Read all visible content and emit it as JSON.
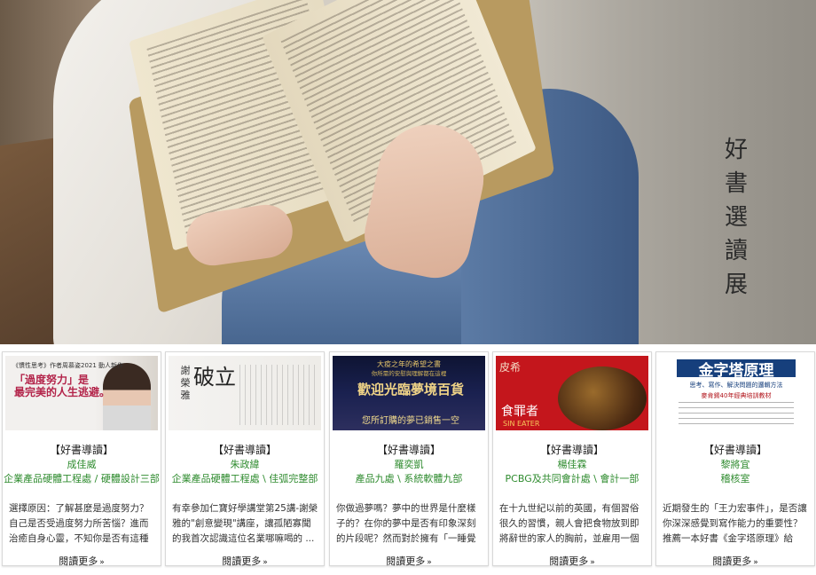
{
  "hero": {
    "title_chars": [
      "好",
      "書",
      "選",
      "讀",
      "展"
    ]
  },
  "cards": [
    {
      "cover": {
        "header": "《慣性思考》作者周慕姿2021 動人新作",
        "title_line1": "「過度努力」是",
        "title_line2": "最完美的人生逃避。"
      },
      "tag": "【好書導讀】",
      "person": "成佳威",
      "dept": "企業產品硬體工程處 / 硬體設計三部",
      "excerpt": "選擇原因：了解甚麼是過度努力？自己是否受過度努力所苦惱？進而治癒自身心靈，不知你是否有這種感覺 ...",
      "more": "閱讀更多"
    },
    {
      "cover": {
        "author": "謝榮雅",
        "title": "破立"
      },
      "tag": "【好書導讀】",
      "person": "朱政緯",
      "dept": "企業產品硬體工程處 \\ 佳弧完整部",
      "excerpt": "有幸參加仁寶好學講堂第25講-謝榮雅的\"創意變現\"講座，讓孤陋寡聞的我首次認識這位名業哪嘛喝的 ...",
      "more": "閱讀更多"
    },
    {
      "cover": {
        "top": "大疫之年的希望之書",
        "top2": "你所需的安慰與理解都在這裡",
        "title": "歡迎光臨夢境百貨",
        "sub": "您所訂購的夢已銷售一空"
      },
      "tag": "【好書導讀】",
      "person": "羅奕凱",
      "dept": "產品九處 \\ 系統軟體九部",
      "excerpt": "你做過夢嗎？夢中的世界是什麼樣子的？在你的夢中是否有印象深刻的片段呢？然而對於擁有「一睡覺就會 ...",
      "more": "閱讀更多"
    },
    {
      "cover": {
        "author": "皮希",
        "title": "食罪者",
        "en": "SIN EATER"
      },
      "tag": "【好書導讀】",
      "person": "楊佳霖",
      "dept": "PCBG及共同會計處 \\ 會計一部",
      "excerpt": "在十九世紀以前的英國，有個習俗很久的習慣，親人會把食物放到即將辭世的家人的胸前，並雇用一個人 ...",
      "more": "閱讀更多"
    },
    {
      "cover": {
        "title": "金字塔原理",
        "sub": "思考、寫作、解決問題的邏輯方法",
        "red": "麥肯錫40年經典培訓教材"
      },
      "tag": "【好書導讀】",
      "person": "黎將宜",
      "dept": "稽核室",
      "excerpt": "近期發生的「王力宏事件」，是否讓你深深感覺到寫作能力的重要性？推薦一本好書《金字塔原理》給您，這是 ...",
      "more": "閱讀更多"
    }
  ]
}
